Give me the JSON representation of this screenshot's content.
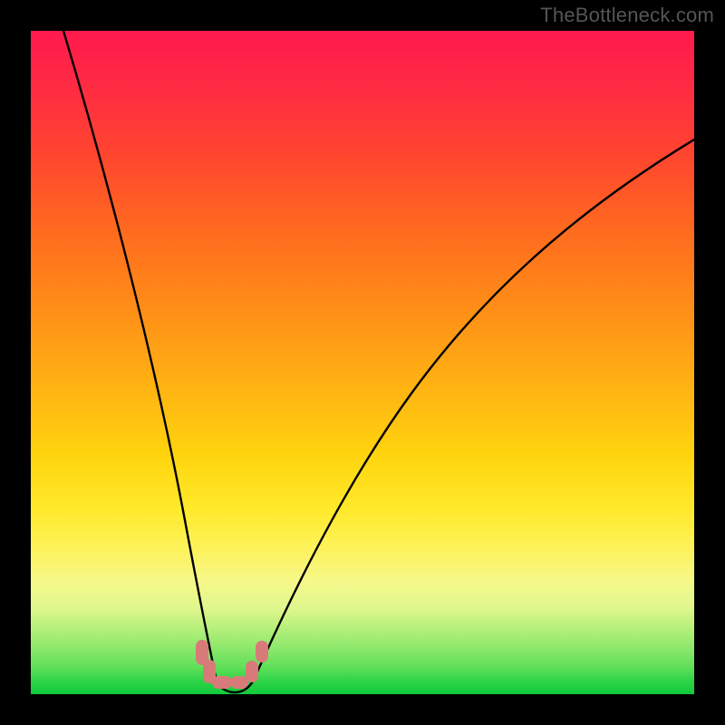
{
  "watermark": "TheBottleneck.com",
  "colors": {
    "bg_black": "#000000",
    "watermark_gray": "#555555",
    "blob_pink": "#d97a7a",
    "curve_black": "#000000",
    "gradient_top": "#ff1a4d",
    "gradient_bottom": "#0fca3c"
  },
  "chart_data": {
    "type": "line",
    "title": "",
    "xlabel": "",
    "ylabel": "",
    "xlim": [
      0,
      100
    ],
    "ylim": [
      0,
      100
    ],
    "grid": false,
    "legend": false,
    "annotations": [],
    "description": "V-shaped bottleneck curve over rainbow heat gradient; minimum sits on green band near x≈28. Pink rounded markers cluster at the trough.",
    "series": [
      {
        "name": "bottleneck-curve",
        "x": [
          5,
          10,
          15,
          20,
          24,
          27,
          28,
          30,
          35,
          42,
          50,
          60,
          70,
          80,
          90,
          100
        ],
        "y": [
          100,
          80,
          58,
          34,
          14,
          3,
          0,
          3,
          13,
          28,
          42,
          55,
          65,
          73,
          79,
          84
        ]
      }
    ],
    "markers": [
      {
        "x": 25.5,
        "y": 7
      },
      {
        "x": 26.3,
        "y": 3.5
      },
      {
        "x": 27.5,
        "y": 1
      },
      {
        "x": 29.0,
        "y": 0.5
      },
      {
        "x": 30.2,
        "y": 1
      },
      {
        "x": 32.8,
        "y": 6
      }
    ]
  }
}
